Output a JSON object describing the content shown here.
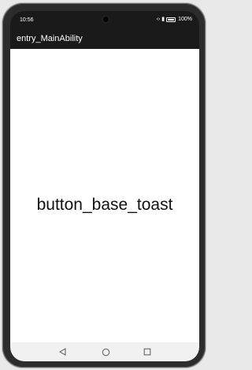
{
  "status_bar": {
    "time": "10:56",
    "icons": [
      "signal-icon",
      "bluetooth-icon",
      "battery-icon"
    ],
    "battery_percent": "100%"
  },
  "app": {
    "title": "entry_MainAbility"
  },
  "main": {
    "text": "button_base_toast"
  },
  "nav_bar": {
    "buttons": [
      "back-icon",
      "home-icon",
      "recents-icon"
    ]
  },
  "colors": {
    "bar_background": "#1a1a1a",
    "content_background": "#ffffff",
    "nav_background": "#f1f1f1"
  }
}
